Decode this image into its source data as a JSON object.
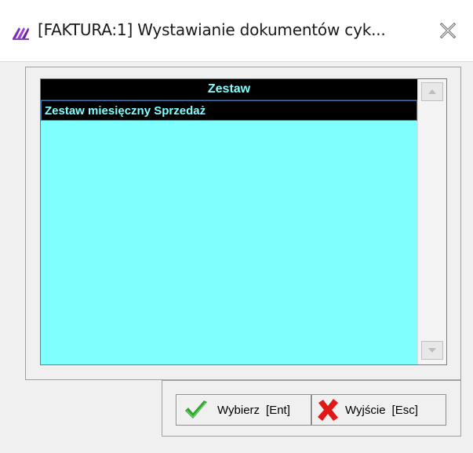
{
  "window": {
    "title": "[FAKTURA:1]  Wystawianie dokumentów cyk...",
    "app_icon": "app-logo-icon",
    "close_icon": "close-icon"
  },
  "grid": {
    "header": "Zestaw",
    "rows": [
      {
        "label": "Zestaw miesięczny Sprzedaż"
      }
    ],
    "colors": {
      "header_bg": "#000000",
      "header_text": "#7fffff",
      "body_bg": "#80ffff",
      "selected_row_bg": "#000000",
      "selected_row_text": "#7fffff"
    }
  },
  "buttons": {
    "select": {
      "label": "Wybierz",
      "shortcut": "[Ent]",
      "icon": "checkmark-icon",
      "color": "#2ea82e"
    },
    "exit": {
      "label": "Wyjście",
      "shortcut": "[Esc]",
      "icon": "red-x-icon",
      "color": "#e01818"
    }
  }
}
